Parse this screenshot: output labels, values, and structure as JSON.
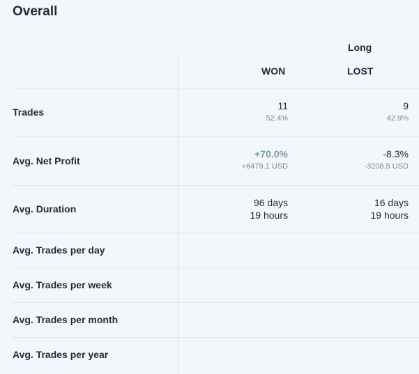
{
  "title": "Overall",
  "headers": {
    "group": "Long",
    "won": "WON",
    "lost": "LOST"
  },
  "rows": [
    {
      "label": "Trades",
      "won_main": "11",
      "won_sub": "52.4%",
      "lost_main": "9",
      "lost_sub": "42.9%"
    },
    {
      "label": "Avg. Net Profit",
      "won_main": "+70.0%",
      "won_sub": "+6479.1 USD",
      "lost_main": "-8.3%",
      "lost_sub": "-3208.5 USD"
    },
    {
      "label": "Avg. Duration",
      "won_main": "96 days",
      "won_sub": "19 hours",
      "lost_main": "16 days",
      "lost_sub": "19 hours"
    },
    {
      "label": "Avg. Trades per day"
    },
    {
      "label": "Avg. Trades per week"
    },
    {
      "label": "Avg. Trades per month"
    },
    {
      "label": "Avg. Trades per year"
    }
  ],
  "colors": {
    "background": "#f2f7fb",
    "text": "#1f2a37",
    "muted": "#7b8d99",
    "positive": "#7a9fa4",
    "divider": "#dfe5eb"
  }
}
